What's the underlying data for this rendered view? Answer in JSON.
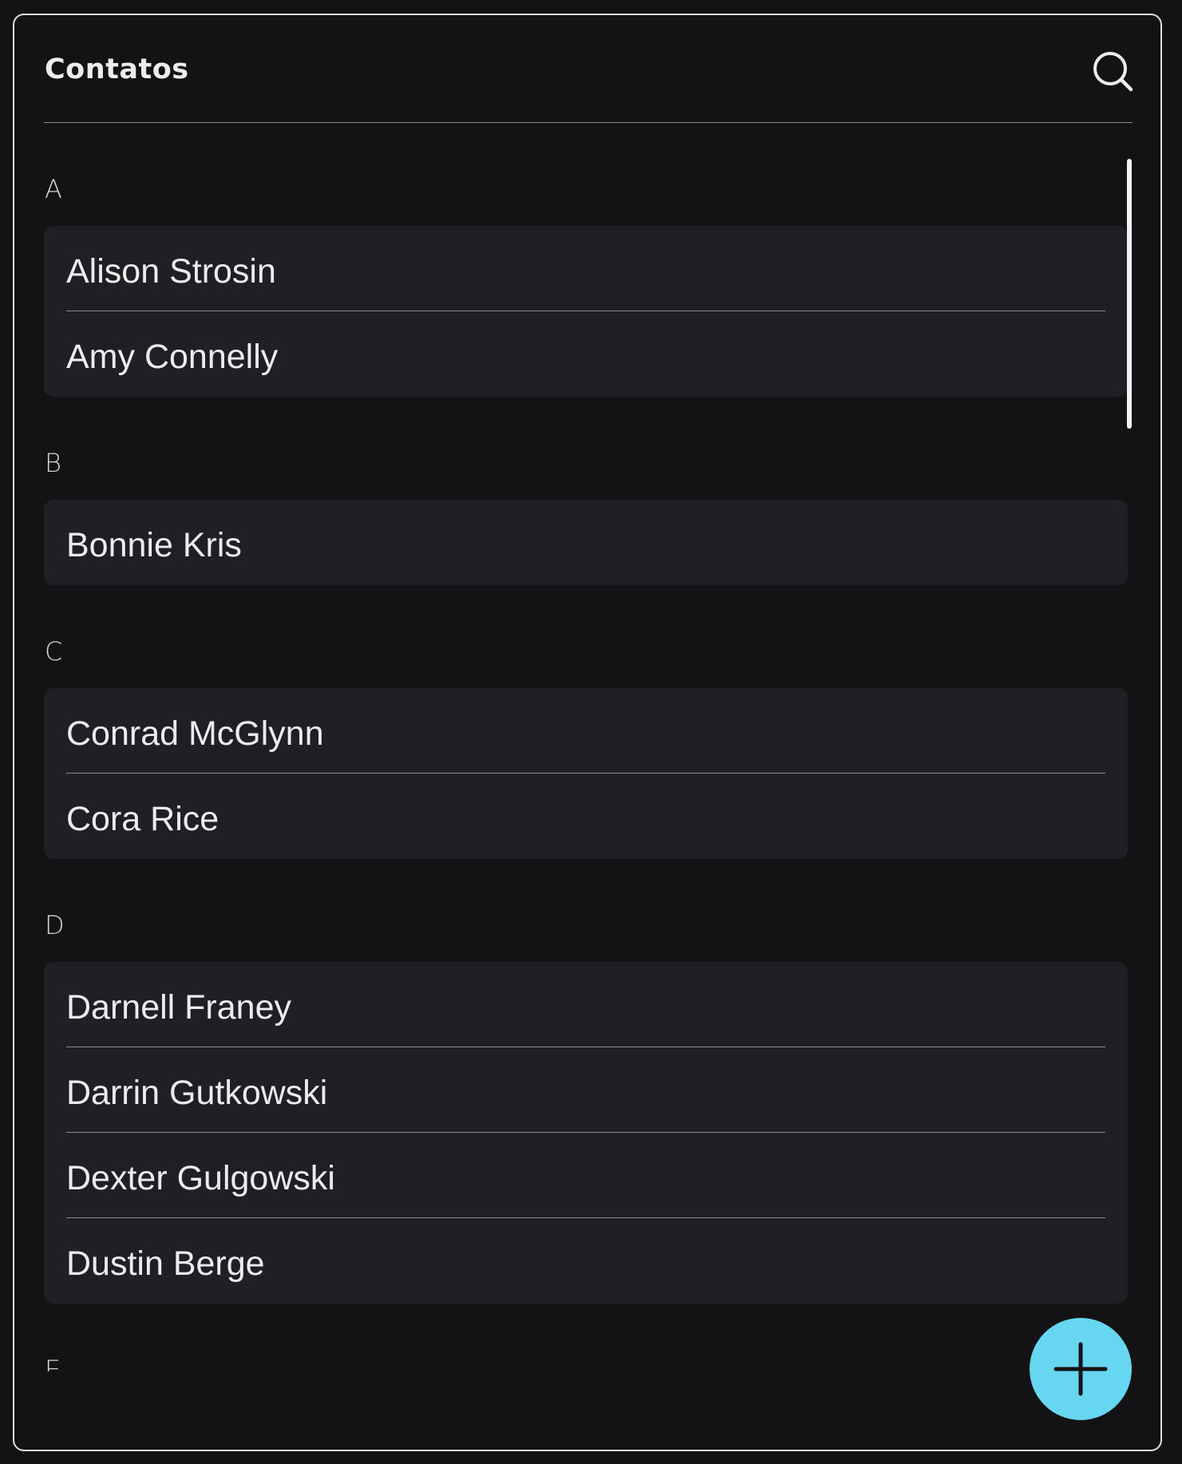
{
  "header": {
    "title": "Contatos",
    "search_icon": "search-icon"
  },
  "sections": [
    {
      "letter": "A",
      "contacts": [
        "Alison Strosin",
        "Amy Connelly"
      ]
    },
    {
      "letter": "B",
      "contacts": [
        "Bonnie Kris"
      ]
    },
    {
      "letter": "C",
      "contacts": [
        "Conrad McGlynn",
        "Cora Rice"
      ]
    },
    {
      "letter": "D",
      "contacts": [
        "Darnell Franey",
        "Darrin Gutkowski",
        "Dexter Gulgowski",
        "Dustin Berge"
      ]
    },
    {
      "letter": "E",
      "contacts": []
    }
  ],
  "fab": {
    "icon": "plus-icon",
    "color": "#67d6f0"
  },
  "colors": {
    "background": "#131316",
    "card": "#202024",
    "text": "#ececee",
    "divider": "#8b8b90"
  }
}
